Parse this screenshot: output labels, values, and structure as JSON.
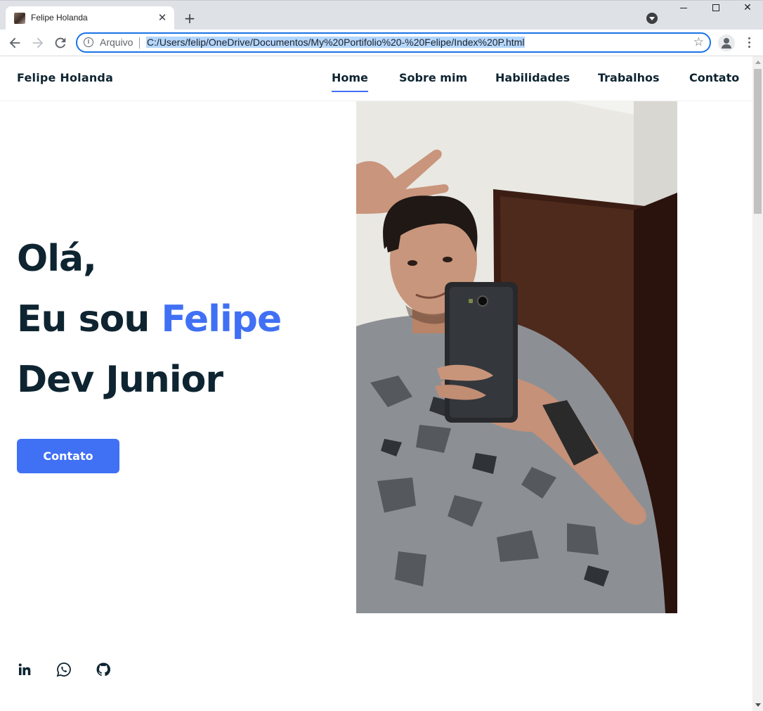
{
  "browser": {
    "tab_title": "Felipe Holanda",
    "scheme_label": "Arquivo",
    "url": "C:/Users/felip/OneDrive/Documentos/My%20Portifolio%20-%20Felipe/Index%20P.html"
  },
  "site": {
    "logo": "Felipe Holanda",
    "nav": [
      "Home",
      "Sobre mim",
      "Habilidades",
      "Trabalhos",
      "Contato"
    ],
    "active_nav": "Home"
  },
  "hero": {
    "greeting": "Olá,",
    "intro_prefix": "Eu sou",
    "name": "Felipe",
    "role": "Dev Junior",
    "cta_label": "Contato",
    "photo_icon": "portrait-photo"
  },
  "social": [
    "linkedin-icon",
    "whatsapp-icon",
    "github-icon"
  ],
  "colors": {
    "accent": "#4070f4",
    "text_dark": "#0e2431",
    "chrome_tabstrip": "#dee1e6",
    "url_highlight": "#b4d7ff"
  }
}
